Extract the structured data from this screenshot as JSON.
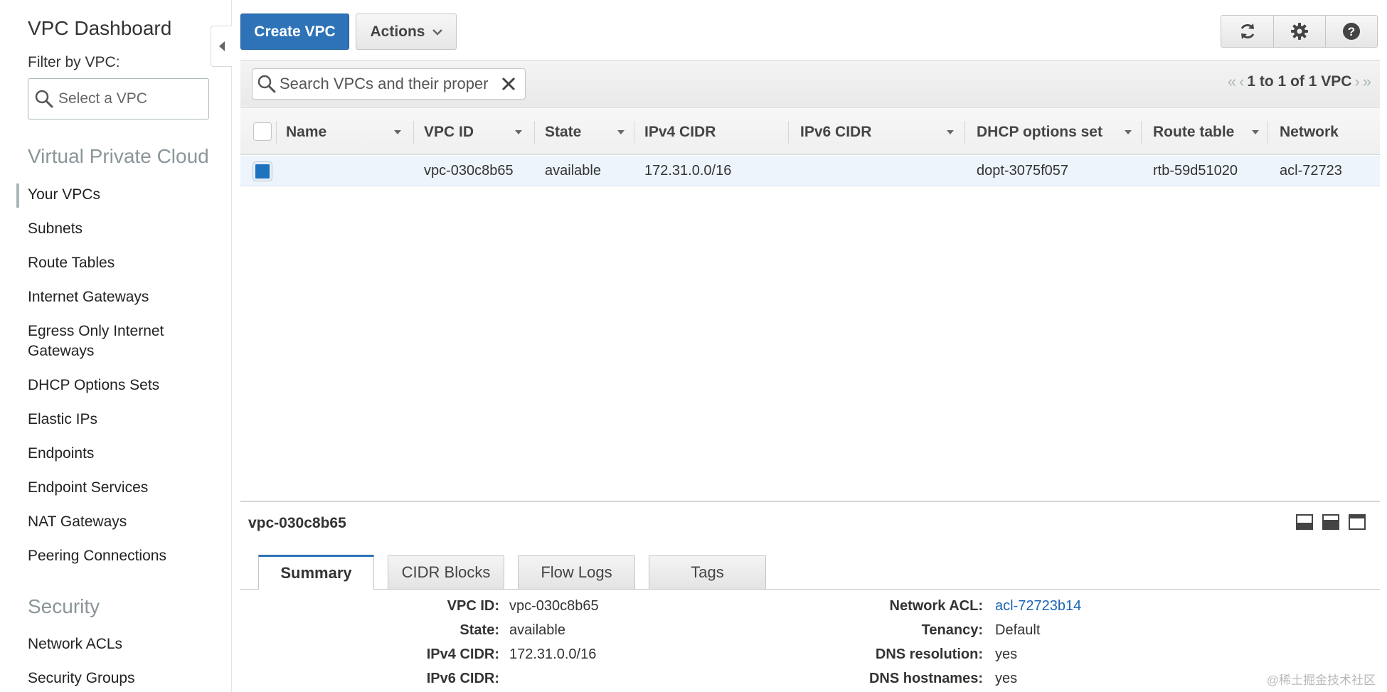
{
  "sidebar": {
    "title": "VPC Dashboard",
    "filter_label": "Filter by VPC:",
    "filter_placeholder": "Select a VPC",
    "section_vpc": "Virtual Private Cloud",
    "items": [
      "Your VPCs",
      "Subnets",
      "Route Tables",
      "Internet Gateways",
      "Egress Only Internet Gateways",
      "DHCP Options Sets",
      "Elastic IPs",
      "Endpoints",
      "Endpoint Services",
      "NAT Gateways",
      "Peering Connections"
    ],
    "section_security": "Security",
    "security_items": [
      "Network ACLs",
      "Security Groups"
    ]
  },
  "toolbar": {
    "create_label": "Create VPC",
    "actions_label": "Actions",
    "icons": [
      "refresh-icon",
      "gear-icon",
      "help-icon"
    ]
  },
  "search": {
    "placeholder": "Search VPCs and their properties",
    "value": "Search VPCs and their proper"
  },
  "pager": {
    "text": "1 to 1 of 1 VPC"
  },
  "table": {
    "columns": [
      "Name",
      "VPC ID",
      "State",
      "IPv4 CIDR",
      "IPv6 CIDR",
      "DHCP options set",
      "Route table",
      "Network"
    ],
    "rows": [
      {
        "name": "",
        "vpc_id": "vpc-030c8b65",
        "state": "available",
        "ipv4_cidr": "172.31.0.0/16",
        "ipv6_cidr": "",
        "dhcp": "dopt-3075f057",
        "route_table": "rtb-59d51020",
        "network_acl": "acl-72723"
      }
    ]
  },
  "detail": {
    "title": "vpc-030c8b65",
    "tabs": [
      "Summary",
      "CIDR Blocks",
      "Flow Logs",
      "Tags"
    ],
    "left": [
      {
        "label": "VPC ID:",
        "value": "vpc-030c8b65"
      },
      {
        "label": "State:",
        "value": "available"
      },
      {
        "label": "IPv4 CIDR:",
        "value": "172.31.0.0/16"
      },
      {
        "label": "IPv6 CIDR:",
        "value": ""
      }
    ],
    "right": [
      {
        "label": "Network ACL:",
        "value": "acl-72723b14"
      },
      {
        "label": "Tenancy:",
        "value": "Default"
      },
      {
        "label": "DNS resolution:",
        "value": "yes"
      },
      {
        "label": "DNS hostnames:",
        "value": "yes"
      }
    ]
  },
  "watermark": "@稀土掘金技术社区",
  "colors": {
    "primary": "#2e73b8",
    "selected_row": "#edf4fb",
    "link": "#1b66b5",
    "section_gray": "#8a9699"
  }
}
